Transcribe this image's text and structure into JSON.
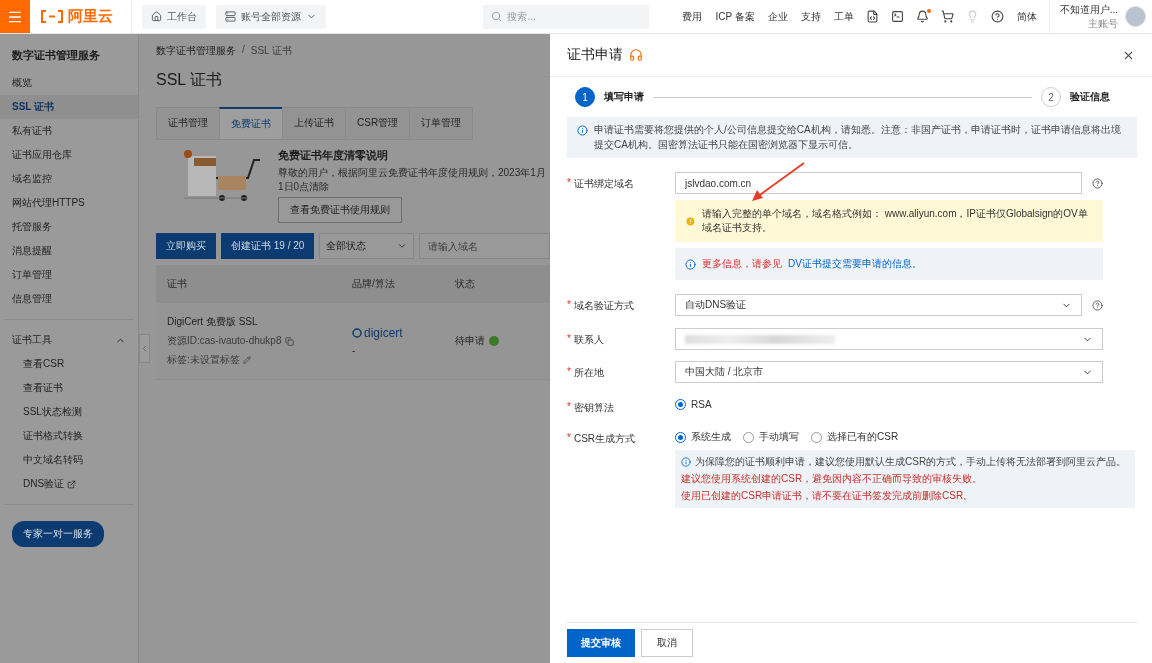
{
  "topbar": {
    "logo": "阿里云",
    "workbench": "工作台",
    "resources": "账号全部资源",
    "search_placeholder": "搜索...",
    "links": [
      "费用",
      "ICP 备案",
      "企业",
      "支持",
      "工单"
    ],
    "language": "简体",
    "user": {
      "name": "不知道用户...",
      "role": "主账号"
    },
    "has_notification": true
  },
  "sidebar": {
    "title": "数字证书管理服务",
    "items": [
      {
        "label": "概览",
        "selected": false
      },
      {
        "label": "SSL 证书",
        "selected": true
      },
      {
        "label": "私有证书",
        "selected": false
      },
      {
        "label": "证书应用仓库",
        "selected": false
      },
      {
        "label": "域名监控",
        "selected": false
      },
      {
        "label": "网站代理HTTPS",
        "selected": false
      },
      {
        "label": "托管服务",
        "selected": false
      },
      {
        "label": "消息提醒",
        "selected": false
      },
      {
        "label": "订单管理",
        "selected": false
      },
      {
        "label": "信息管理",
        "selected": false
      }
    ],
    "tools": {
      "label": "证书工具",
      "expanded": true,
      "items": [
        {
          "label": "查看CSR",
          "external": false
        },
        {
          "label": "查看证书",
          "external": false
        },
        {
          "label": "SSL状态检测",
          "external": false
        },
        {
          "label": "证书格式转换",
          "external": false
        },
        {
          "label": "中文域名转码",
          "external": false
        },
        {
          "label": "DNS验证",
          "external": true
        }
      ]
    },
    "expert_button": "专家一对一服务"
  },
  "main": {
    "breadcrumb": [
      "数字证书管理服务",
      "SSL 证书"
    ],
    "breadcrumb_separator": "/",
    "title": "SSL 证书",
    "tabs": [
      {
        "label": "证书管理",
        "selected": false
      },
      {
        "label": "免费证书",
        "selected": true
      },
      {
        "label": "上传证书",
        "selected": false
      },
      {
        "label": "CSR管理",
        "selected": false
      },
      {
        "label": "订单管理",
        "selected": false
      }
    ],
    "notice": {
      "title": "免费证书年度清零说明",
      "text": "尊敬的用户，根据阿里云免费证书年度使用规则，2023年1月1日0点清除",
      "button": "查看免费证书使用规则"
    },
    "toolbar": {
      "buy": "立即购买",
      "create": "创建证书 19 / 20",
      "status": "全部状态",
      "search_placeholder": "请输入域名"
    },
    "table": {
      "columns": [
        "证书",
        "品牌/算法",
        "状态"
      ],
      "rows": [
        {
          "name": "DigiCert 免费版 SSL",
          "resource_id": "资源ID:cas-ivauto-dhukp8",
          "tag": "标签:未设置标签",
          "brand": "digicert",
          "algorithm": "-",
          "status": "待申请"
        }
      ]
    }
  },
  "drawer": {
    "title": "证书申请",
    "steps": [
      {
        "number": "1",
        "label": "填写申请",
        "active": true
      },
      {
        "number": "2",
        "label": "验证信息",
        "active": false
      }
    ],
    "info": "申请证书需要将您提供的个人/公司信息提交给CA机构，请知悉。注意：非国产证书，申请证书时，证书申请信息将出境提交CA机构。国密算法证书只能在国密浏览器下显示可信。",
    "fields": [
      {
        "kind": "input",
        "mark": "*",
        "label": "证书绑定域名",
        "value": "jslvdao.com.cn",
        "help": true,
        "warning": "请输入完整的单个域名，域名格式例如： www.aliyun.com，IP证书仅Globalsign的OV单域名证书支持。",
        "more": {
          "text": "更多信息，请参见",
          "link": "DV证书提交需要申请的信息。"
        }
      },
      {
        "kind": "select",
        "mark": "*",
        "label": "域名验证方式",
        "value": "自动DNS验证",
        "help": true
      },
      {
        "kind": "blurred",
        "mark": "*",
        "label": "联系人"
      },
      {
        "kind": "select",
        "mark": "*",
        "label": "所在地",
        "value": "中国大陆 / 北京市"
      },
      {
        "kind": "radio",
        "mark": "*",
        "label": "密钥算法",
        "options": [
          {
            "label": "RSA",
            "selected": true
          }
        ]
      },
      {
        "kind": "radio",
        "mark": "*",
        "label": "CSR生成方式",
        "options": [
          {
            "label": "系统生成",
            "selected": true
          },
          {
            "label": "手动填写",
            "selected": false
          },
          {
            "label": "选择已有的CSR",
            "selected": false
          }
        ],
        "notes": [
          {
            "kind": "info",
            "text": "为保障您的证书顺利申请，建议您使用默认生成CSR的方式，手动上传将无法部署到阿里云产品。"
          },
          {
            "kind": "danger",
            "text": "建议您使用系统创建的CSR，避免因内容不正确而导致的审核失败。"
          },
          {
            "kind": "danger",
            "text": "使用已创建的CSR申请证书，请不要在证书签发完成前删除CSR。"
          }
        ]
      }
    ],
    "buttons": [
      {
        "kind": "primary",
        "label": "提交审核"
      },
      {
        "kind": "secondary",
        "label": "取消"
      }
    ]
  }
}
